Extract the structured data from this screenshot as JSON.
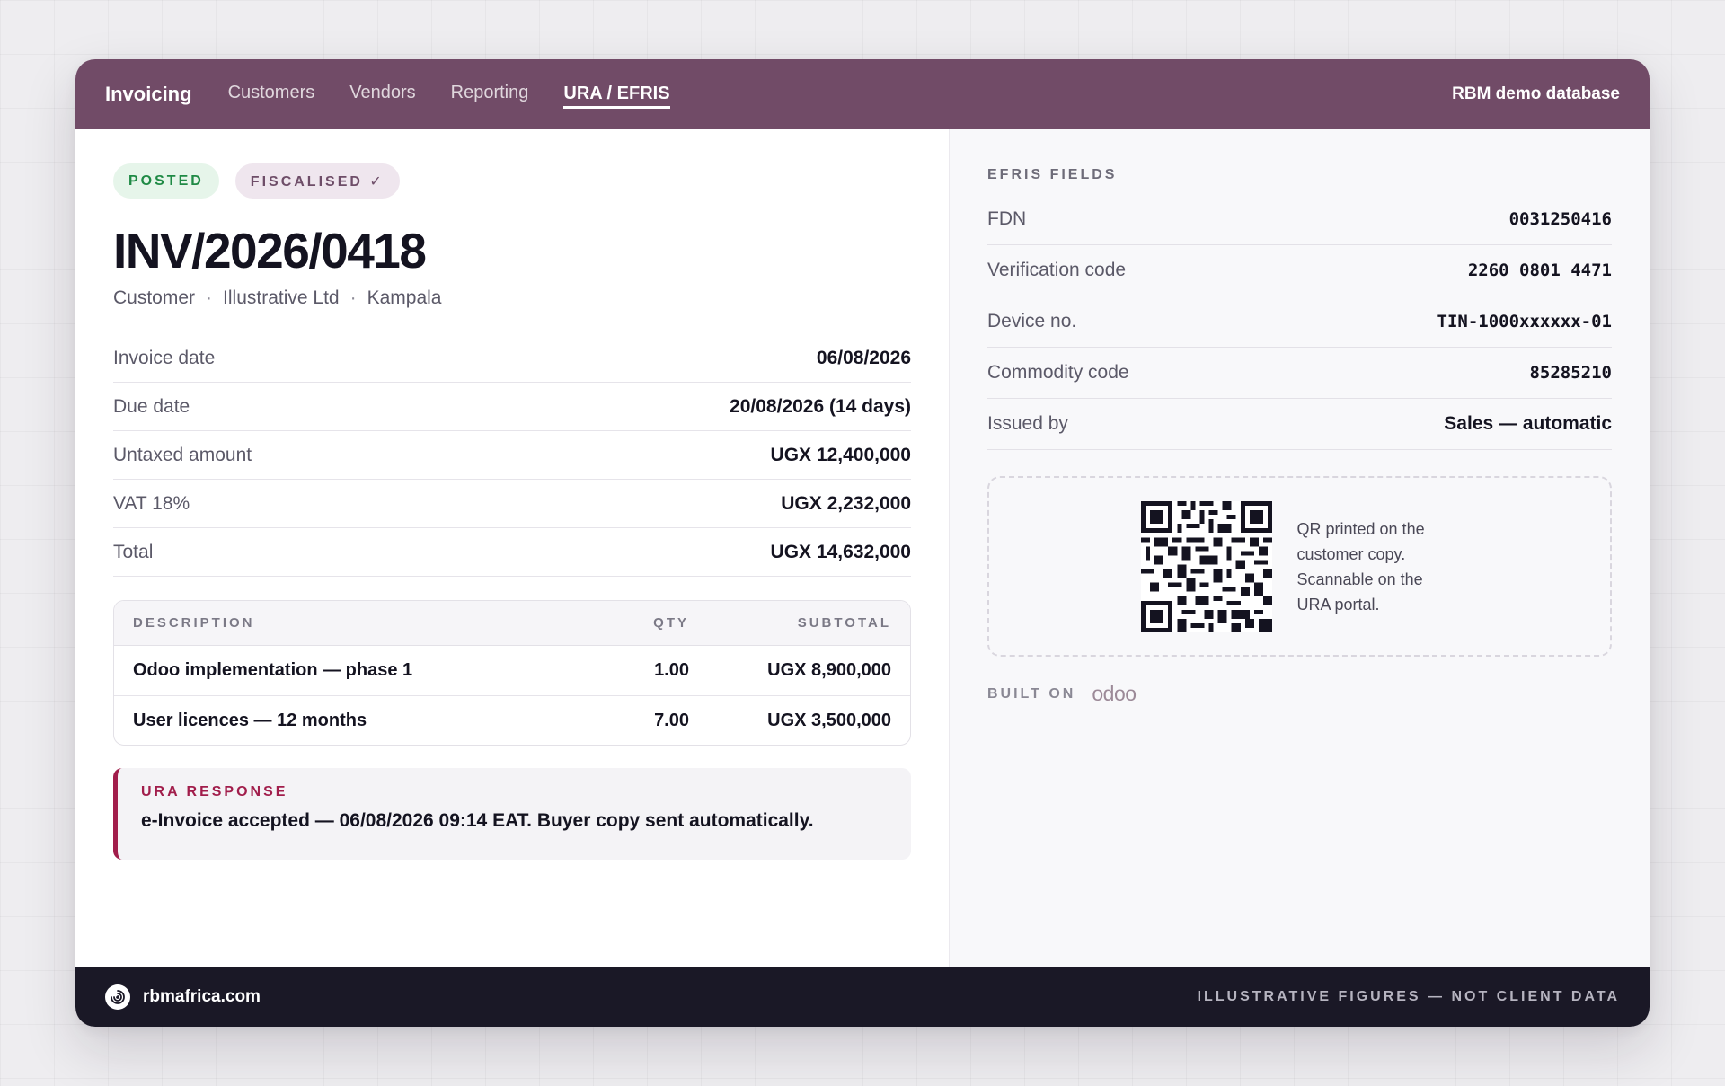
{
  "nav": {
    "brand": "Invoicing",
    "items": [
      "Customers",
      "Vendors",
      "Reporting",
      "URA / EFRIS"
    ],
    "active": "URA / EFRIS",
    "database": "RBM demo database"
  },
  "invoice": {
    "status_badges": [
      "POSTED",
      "FISCALISED ✓"
    ],
    "number": "INV/2026/0418",
    "customer_label": "Customer",
    "customer_name": "Illustrative Ltd",
    "customer_city": "Kampala",
    "summary": [
      {
        "label": "Invoice date",
        "value": "06/08/2026"
      },
      {
        "label": "Due date",
        "value": "20/08/2026  (14 days)"
      },
      {
        "label": "Untaxed amount",
        "value": "UGX 12,400,000"
      },
      {
        "label": "VAT 18%",
        "value": "UGX 2,232,000"
      },
      {
        "label": "Total",
        "value": "UGX 14,632,000"
      }
    ],
    "lines_header": {
      "description": "DESCRIPTION",
      "qty": "QTY",
      "subtotal": "SUBTOTAL"
    },
    "lines": [
      {
        "description": "Odoo implementation — phase 1",
        "qty": "1.00",
        "subtotal": "UGX 8,900,000"
      },
      {
        "description": "User licences — 12 months",
        "qty": "7.00",
        "subtotal": "UGX 3,500,000"
      }
    ],
    "ura_response": {
      "title": "URA RESPONSE",
      "text": "e-Invoice accepted — 06/08/2026 09:14 EAT. Buyer copy sent automatically."
    }
  },
  "efris": {
    "title": "EFRIS FIELDS",
    "fields": [
      {
        "label": "FDN",
        "value": "0031250416"
      },
      {
        "label": "Verification code",
        "value": "2260 0801 4471"
      },
      {
        "label": "Device no.",
        "value": "TIN-1000xxxxxx-01"
      },
      {
        "label": "Commodity code",
        "value": "85285210"
      },
      {
        "label": "Issued by",
        "value": "Sales — automatic"
      }
    ],
    "qr_caption": "QR printed on the customer copy. Scannable on the URA portal.",
    "built_on_label": "BUILT ON",
    "built_on_brand": "odoo"
  },
  "footer": {
    "site": "rbmafrica.com",
    "note": "ILLUSTRATIVE FIGURES — NOT CLIENT DATA"
  },
  "colors": {
    "header": "#714b67",
    "footer": "#1a1826",
    "posted": "#1f8a45",
    "ura_accent": "#a11d4b"
  }
}
